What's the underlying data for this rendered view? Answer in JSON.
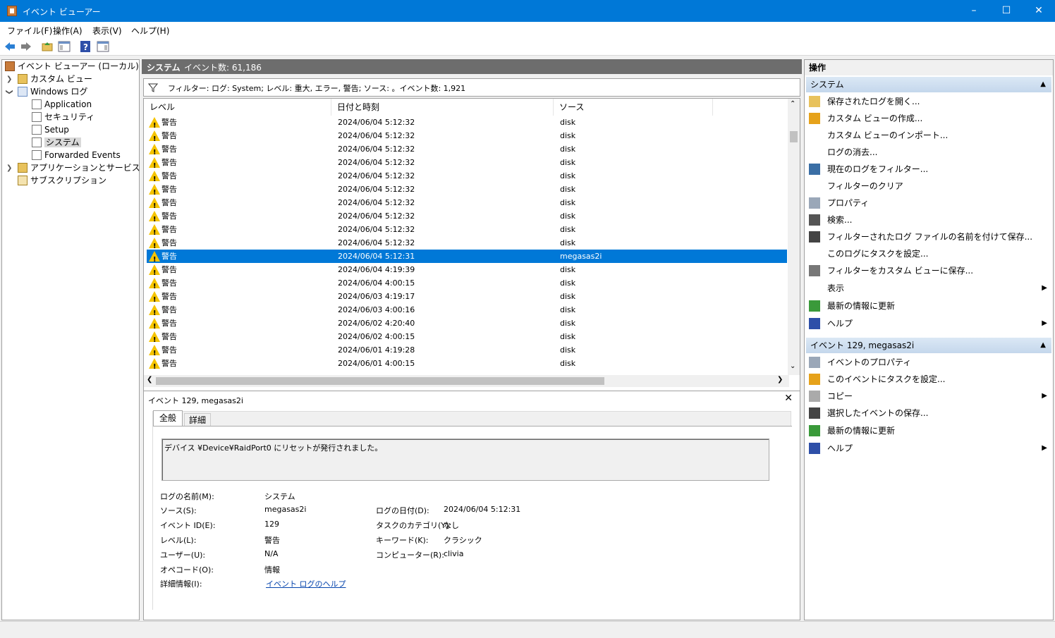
{
  "window": {
    "title": "イベント ビューアー"
  },
  "menu": [
    "ファイル(F)",
    "操作(A)",
    "表示(V)",
    "ヘルプ(H)"
  ],
  "tree": {
    "root": "イベント ビューアー (ローカル)",
    "custom_views": "カスタム ビュー",
    "windows_logs": "Windows ログ",
    "logs": [
      "Application",
      "セキュリティ",
      "Setup",
      "システム",
      "Forwarded Events"
    ],
    "app_service_logs": "アプリケーションとサービス ログ",
    "subscriptions": "サブスクリプション"
  },
  "center": {
    "header_title": "システム",
    "header_count": "イベント数: 61,186",
    "filter_text": "フィルター: ログ: System; レベル: 重大, エラー, 警告; ソース: 。イベント数: 1,921",
    "columns": [
      "レベル",
      "日付と時刻",
      "ソース"
    ],
    "rows": [
      {
        "level": "警告",
        "date": "2024/06/04 5:12:32",
        "source": "disk"
      },
      {
        "level": "警告",
        "date": "2024/06/04 5:12:32",
        "source": "disk"
      },
      {
        "level": "警告",
        "date": "2024/06/04 5:12:32",
        "source": "disk"
      },
      {
        "level": "警告",
        "date": "2024/06/04 5:12:32",
        "source": "disk"
      },
      {
        "level": "警告",
        "date": "2024/06/04 5:12:32",
        "source": "disk"
      },
      {
        "level": "警告",
        "date": "2024/06/04 5:12:32",
        "source": "disk"
      },
      {
        "level": "警告",
        "date": "2024/06/04 5:12:32",
        "source": "disk"
      },
      {
        "level": "警告",
        "date": "2024/06/04 5:12:32",
        "source": "disk"
      },
      {
        "level": "警告",
        "date": "2024/06/04 5:12:32",
        "source": "disk"
      },
      {
        "level": "警告",
        "date": "2024/06/04 5:12:32",
        "source": "disk"
      },
      {
        "level": "警告",
        "date": "2024/06/04 5:12:31",
        "source": "megasas2i"
      },
      {
        "level": "警告",
        "date": "2024/06/04 4:19:39",
        "source": "disk"
      },
      {
        "level": "警告",
        "date": "2024/06/04 4:00:15",
        "source": "disk"
      },
      {
        "level": "警告",
        "date": "2024/06/03 4:19:17",
        "source": "disk"
      },
      {
        "level": "警告",
        "date": "2024/06/03 4:00:16",
        "source": "disk"
      },
      {
        "level": "警告",
        "date": "2024/06/02 4:20:40",
        "source": "disk"
      },
      {
        "level": "警告",
        "date": "2024/06/02 4:00:15",
        "source": "disk"
      },
      {
        "level": "警告",
        "date": "2024/06/01 4:19:28",
        "source": "disk"
      },
      {
        "level": "警告",
        "date": "2024/06/01 4:00:15",
        "source": "disk"
      }
    ],
    "selected_index": 10
  },
  "detail": {
    "title": "イベント 129, megasas2i",
    "tabs": [
      "全般",
      "詳細"
    ],
    "message": "デバイス ¥Device¥RaidPort0 にリセットが発行されました。",
    "log_name_label": "ログの名前(M):",
    "log_name": "システム",
    "source_label": "ソース(S):",
    "source": "megasas2i",
    "logged_label": "ログの日付(D):",
    "logged": "2024/06/04 5:12:31",
    "event_id_label": "イベント ID(E):",
    "event_id": "129",
    "task_label": "タスクのカテゴリ(Y):",
    "task": "なし",
    "level_label": "レベル(L):",
    "level": "警告",
    "keywords_label": "キーワード(K):",
    "keywords": "クラシック",
    "user_label": "ユーザー(U):",
    "user": "N/A",
    "computer_label": "コンピューター(R):",
    "computer": "clivia",
    "opcode_label": "オペコード(O):",
    "opcode": "情報",
    "more_label": "詳細情報(I):",
    "more_link": "イベント ログのヘルプ"
  },
  "actions": {
    "title": "操作",
    "section1": "システム",
    "items1": [
      "保存されたログを開く...",
      "カスタム ビューの作成...",
      "カスタム ビューのインポート...",
      "ログの消去...",
      "現在のログをフィルター...",
      "フィルターのクリア",
      "プロパティ",
      "検索...",
      "フィルターされたログ ファイルの名前を付けて保存...",
      "このログにタスクを設定...",
      "フィルターをカスタム ビューに保存...",
      "表示",
      "最新の情報に更新",
      "ヘルプ"
    ],
    "section2": "イベント 129, megasas2i",
    "items2": [
      "イベントのプロパティ",
      "このイベントにタスクを設定...",
      "コピー",
      "選択したイベントの保存...",
      "最新の情報に更新",
      "ヘルプ"
    ]
  }
}
